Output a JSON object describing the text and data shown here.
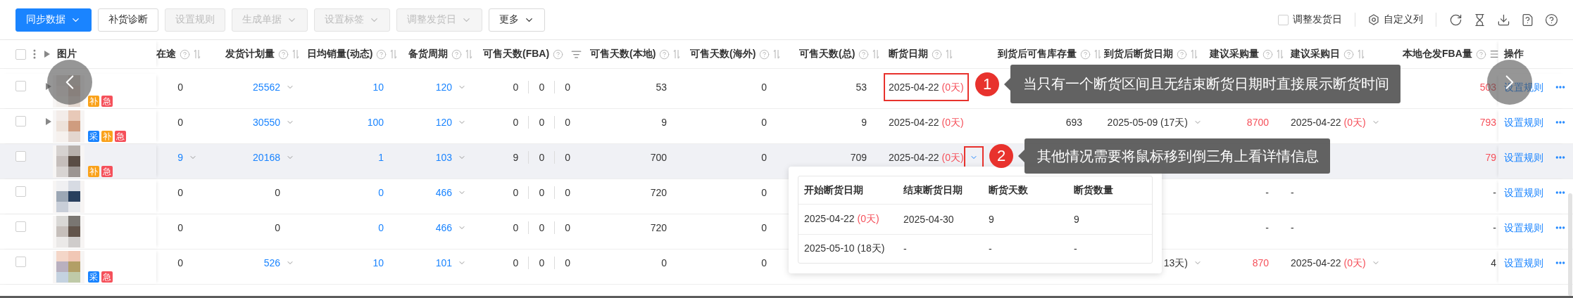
{
  "toolbar": {
    "buttons": [
      {
        "label": "同步数据",
        "kind": "primary",
        "dropdown": true,
        "disabled": false
      },
      {
        "label": "补货诊断",
        "kind": "default",
        "dropdown": false,
        "disabled": false
      },
      {
        "label": "设置规则",
        "kind": "default",
        "dropdown": false,
        "disabled": true
      },
      {
        "label": "生成单据",
        "kind": "default",
        "dropdown": true,
        "disabled": true
      },
      {
        "label": "设置标签",
        "kind": "default",
        "dropdown": true,
        "disabled": true
      },
      {
        "label": "调整发货日",
        "kind": "default",
        "dropdown": true,
        "disabled": true
      },
      {
        "label": "更多",
        "kind": "default",
        "dropdown": true,
        "disabled": false
      }
    ],
    "option": {
      "label": "调整发货日",
      "checked": false
    },
    "custom_columns": {
      "label": "自定义列"
    }
  },
  "table": {
    "header_checked": false,
    "picture_header": "图片",
    "columns": [
      {
        "label": "在途",
        "help": true,
        "kind": "sort"
      },
      {
        "label": "发货计划量",
        "help": true,
        "kind": "sort"
      },
      {
        "label": "日均销量(动态)",
        "help": true,
        "kind": "sort"
      },
      {
        "label": "备货周期",
        "help": true,
        "kind": "sort"
      },
      {
        "label": "可售天数(FBA)",
        "help": true,
        "kind": "filter"
      },
      {
        "label": "可售天数(本地)",
        "help": true,
        "kind": "sort"
      },
      {
        "label": "可售天数(海外)",
        "help": true,
        "kind": "sort"
      },
      {
        "label": "可售天数(总)",
        "help": true,
        "kind": "sort"
      },
      {
        "label": "断货日期",
        "help": true,
        "kind": "sort"
      },
      {
        "label": "到货后可售库存量",
        "help": true,
        "kind": "sort"
      },
      {
        "label": "到货后断货日期",
        "help": true,
        "kind": "sort"
      },
      {
        "label": "建议采购量",
        "help": true,
        "kind": "sort"
      },
      {
        "label": "建议采购日",
        "help": true,
        "kind": "sort"
      },
      {
        "label": "本地仓发FBA量",
        "help": true,
        "kind": "columns"
      },
      {
        "label": "操作",
        "help": false,
        "kind": "plain"
      }
    ],
    "rows": [
      {
        "checked": false,
        "expandable": true,
        "highlighted": false,
        "tags": [
          {
            "label": "补",
            "color": "#faa21b"
          },
          {
            "label": "急",
            "color": "#f5505a"
          }
        ],
        "action": "设置规则",
        "cells": [
          {
            "text": "0"
          },
          {
            "text": "25562",
            "link": true,
            "dropdown": true
          },
          {
            "text": "10",
            "link": true
          },
          {
            "text": "120",
            "link": true,
            "dropdown": true
          },
          {
            "parts": [
              "0",
              "0",
              "0"
            ]
          },
          {
            "text": "53"
          },
          {
            "text": "0"
          },
          {
            "text": "53"
          },
          {
            "text": "2025-04-22",
            "note": "(0天)",
            "framed": true
          },
          null,
          null,
          null,
          null,
          {
            "text": "503",
            "alert": true
          }
        ]
      },
      {
        "checked": false,
        "expandable": true,
        "highlighted": false,
        "tags": [
          {
            "label": "采",
            "color": "#1a84ff"
          },
          {
            "label": "补",
            "color": "#faa21b"
          },
          {
            "label": "急",
            "color": "#f5505a"
          }
        ],
        "action": "设置规则",
        "cells": [
          {
            "text": "0"
          },
          {
            "text": "30550",
            "link": true,
            "dropdown": true
          },
          {
            "text": "100",
            "link": true
          },
          {
            "text": "120",
            "link": true,
            "dropdown": true
          },
          {
            "parts": [
              "0",
              "0",
              "0"
            ]
          },
          {
            "text": "9"
          },
          {
            "text": "0"
          },
          {
            "text": "9"
          },
          {
            "text": "2025-04-22",
            "note": "(0天)"
          },
          {
            "text": "693"
          },
          {
            "text": "2025-05-09 (17天)",
            "dropdown": true
          },
          {
            "text": "8700",
            "alert": true
          },
          {
            "text": "2025-04-22",
            "note": "(0天)",
            "dropdown": true
          },
          {
            "text": "793",
            "alert": true
          }
        ]
      },
      {
        "checked": false,
        "expandable": false,
        "highlighted": true,
        "tags": [
          {
            "label": "补",
            "color": "#faa21b"
          },
          {
            "label": "急",
            "color": "#f5505a"
          }
        ],
        "action": "设置规则",
        "cells": [
          {
            "text": "9",
            "link": true,
            "dropdown": true
          },
          {
            "text": "20168",
            "link": true,
            "dropdown": true
          },
          {
            "text": "1",
            "link": true
          },
          {
            "text": "103",
            "link": true,
            "dropdown": true
          },
          {
            "parts": [
              "9",
              "0",
              "0"
            ]
          },
          {
            "text": "700"
          },
          {
            "text": "0"
          },
          {
            "text": "709"
          },
          {
            "text": "2025-04-22",
            "note": "(0天)",
            "dropdown": true,
            "chevron_framed": true
          },
          null,
          null,
          null,
          null,
          {
            "text": "79",
            "alert": true
          }
        ]
      },
      {
        "checked": false,
        "expandable": false,
        "highlighted": false,
        "tags": [],
        "action": "设置规则",
        "cells": [
          {
            "text": "0"
          },
          {
            "text": "0"
          },
          {
            "text": "0",
            "link": true
          },
          {
            "text": "466",
            "link": true,
            "dropdown": true
          },
          {
            "parts": [
              "0",
              "0",
              "0"
            ]
          },
          {
            "text": "720"
          },
          {
            "text": "0"
          },
          null,
          null,
          null,
          null,
          {
            "text": "-"
          },
          {
            "text": "-"
          },
          {
            "text": "-"
          }
        ]
      },
      {
        "checked": false,
        "expandable": false,
        "highlighted": false,
        "tags": [],
        "action": "设置规则",
        "cells": [
          {
            "text": "0"
          },
          {
            "text": "0"
          },
          {
            "text": "0",
            "link": true
          },
          {
            "text": "466",
            "link": true,
            "dropdown": true
          },
          {
            "parts": [
              "0",
              "0",
              "0"
            ]
          },
          {
            "text": "720"
          },
          {
            "text": "0"
          },
          null,
          null,
          null,
          null,
          {
            "text": "-"
          },
          {
            "text": "-"
          },
          {
            "text": "-"
          }
        ]
      },
      {
        "checked": false,
        "expandable": false,
        "highlighted": false,
        "tags": [
          {
            "label": "采",
            "color": "#1a84ff"
          },
          {
            "label": "急",
            "color": "#f5505a"
          }
        ],
        "action": "设置规则",
        "cells": [
          {
            "text": "0"
          },
          {
            "text": "526",
            "link": true,
            "dropdown": true
          },
          {
            "text": "10",
            "link": true
          },
          {
            "text": "101",
            "link": true,
            "dropdown": true
          },
          {
            "parts": [
              "0",
              "0",
              "0"
            ]
          },
          {
            "text": "0"
          },
          {
            "text": "0"
          },
          null,
          null,
          null,
          {
            "text": "13天)",
            "dropdown": true
          },
          {
            "text": "870",
            "alert": true
          },
          {
            "text": "2025-04-22",
            "note": "(0天)",
            "dropdown": true
          },
          {
            "text": "4"
          }
        ]
      }
    ]
  },
  "popover": {
    "columns": [
      "开始断货日期",
      "结束断货日期",
      "断货天数",
      "断货数量"
    ],
    "rows": [
      [
        {
          "text": "2025-04-22",
          "note": "(0天)"
        },
        {
          "text": "2025-04-30"
        },
        {
          "text": "9"
        },
        {
          "text": "9"
        }
      ],
      [
        {
          "text": "2025-05-10 (18天)"
        },
        {
          "text": "-"
        },
        {
          "text": "-"
        },
        {
          "text": "-"
        }
      ]
    ]
  },
  "callouts": [
    {
      "number": "1",
      "text": "当只有一个断货区间且无结束断货日期时直接展示断货时间"
    },
    {
      "number": "2",
      "text": "其他情况需要将鼠标移到倒三角上看详情信息"
    }
  ]
}
